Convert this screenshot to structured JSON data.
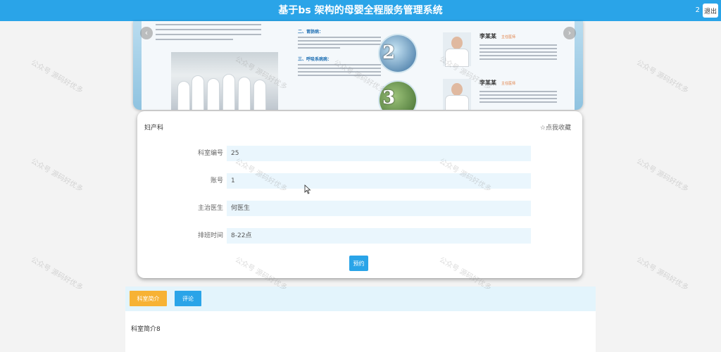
{
  "header": {
    "title": "基于bs 架构的母婴全程服务管理系统",
    "user": "2",
    "logout_label": "退出"
  },
  "banner": {
    "section_titles": [
      "二、胃肠病：",
      "三、呼吸系病病："
    ],
    "numbers": [
      "2",
      "3"
    ],
    "doctors": [
      {
        "name": "李某某",
        "title": "主任医师"
      },
      {
        "name": "李某某",
        "title": "主任医师"
      }
    ],
    "prev_icon": "chevron-left-icon",
    "next_icon": "chevron-right-icon"
  },
  "detail": {
    "department": "妇产科",
    "favorite_label": "☆点我收藏",
    "fields": [
      {
        "label": "科室编号",
        "value": "25"
      },
      {
        "label": "账号",
        "value": "1"
      },
      {
        "label": "主治医生",
        "value": "何医生"
      },
      {
        "label": "排班时间",
        "value": "8-22点"
      }
    ],
    "reserve_label": "预约"
  },
  "tabs": {
    "intro_label": "科室简介",
    "comment_label": "评论"
  },
  "content": {
    "text": "科室简介8"
  },
  "watermark": "公众号 源码好优多",
  "colors": {
    "primary": "#2aa4e8",
    "accent": "#f7b234",
    "field_bg": "#eaf6fd"
  }
}
